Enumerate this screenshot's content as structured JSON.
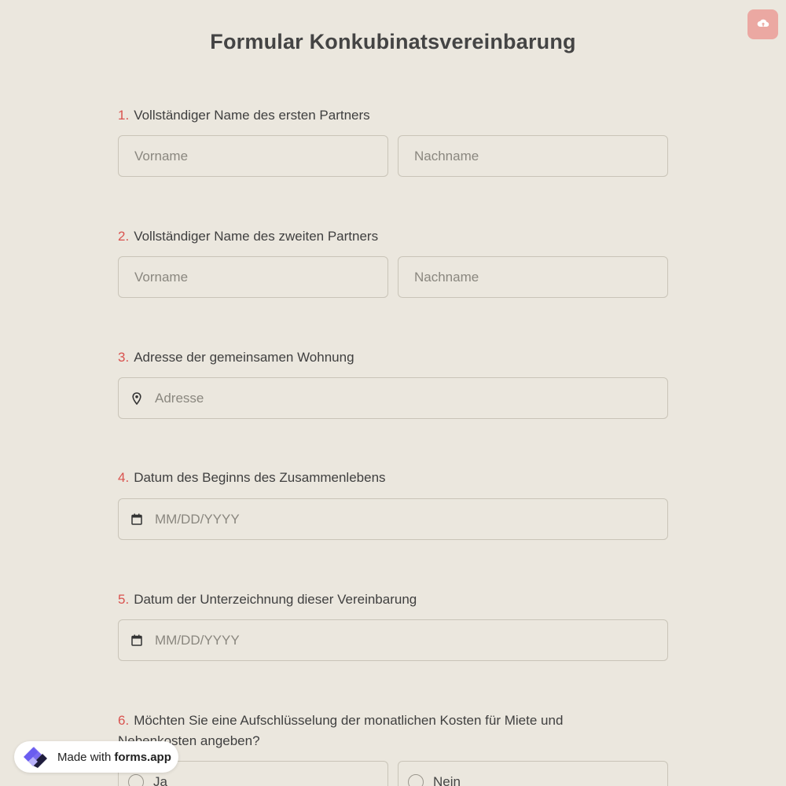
{
  "form": {
    "title": "Formular Konkubinatsvereinbarung"
  },
  "questions": [
    {
      "num": "1.",
      "label": "Vollständiger Name des ersten Partners",
      "first_placeholder": "Vorname",
      "last_placeholder": "Nachname"
    },
    {
      "num": "2.",
      "label": "Vollständiger Name des zweiten Partners",
      "first_placeholder": "Vorname",
      "last_placeholder": "Nachname"
    },
    {
      "num": "3.",
      "label": "Adresse der gemeinsamen Wohnung",
      "placeholder": "Adresse",
      "icon": "map-pin-icon"
    },
    {
      "num": "4.",
      "label": "Datum des Beginns des Zusammenlebens",
      "placeholder": "MM/DD/YYYY",
      "icon": "calendar-icon"
    },
    {
      "num": "5.",
      "label": "Datum der Unterzeichnung dieser Vereinbarung",
      "placeholder": "MM/DD/YYYY",
      "icon": "calendar-icon"
    },
    {
      "num": "6.",
      "label": "Möchten Sie eine Aufschlüsselung der monatlichen Kosten für Miete und Nebenkosten angeben?",
      "options": [
        "Ja",
        "Nein"
      ]
    }
  ],
  "badge": {
    "made_with": "Made with",
    "brand": "forms.app"
  },
  "colors": {
    "background": "#ebe7de",
    "accent_number": "#d9534f",
    "upload_button": "#eba8a2"
  }
}
